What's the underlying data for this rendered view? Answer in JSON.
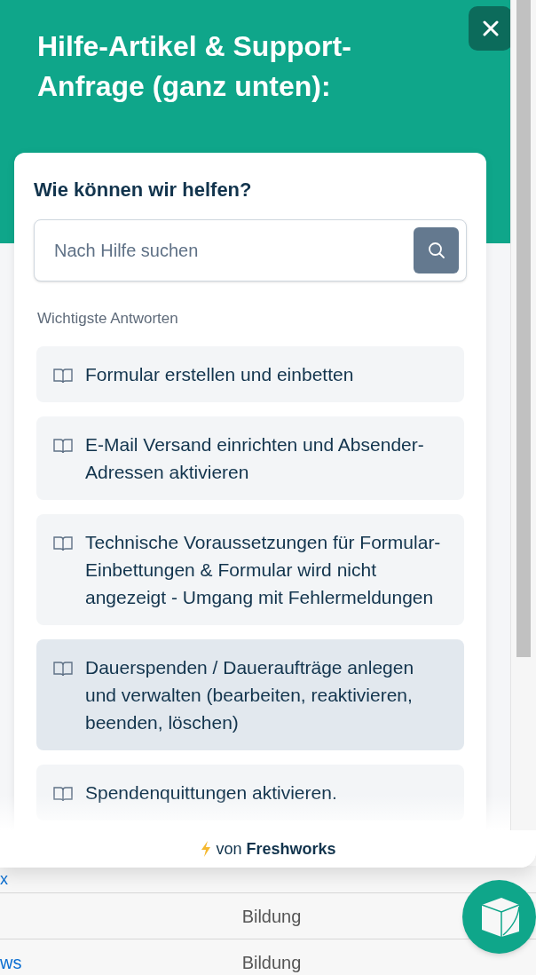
{
  "background_page": {
    "link_top": "x",
    "rows": [
      {
        "link": "",
        "category": "Bildung"
      },
      {
        "link": "ws",
        "category": "Bildung"
      }
    ]
  },
  "widget": {
    "title": "Hilfe-Artikel & Support-Anfrage (ganz unten):",
    "heading": "Wie können wir helfen?",
    "search": {
      "placeholder": "Nach Hilfe suchen"
    },
    "section_label": "Wichtigste Antworten",
    "articles": [
      {
        "title": "Formular erstellen und einbetten",
        "highlighted": false
      },
      {
        "title": "E-Mail Versand einrichten und Absender-Adressen aktivieren",
        "highlighted": false
      },
      {
        "title": "Technische Voraussetzungen für Formular-Einbettungen & Formular wird nicht angezeigt - Umgang mit Fehlermeldungen",
        "highlighted": false
      },
      {
        "title": "Dauerspenden / Daueraufträge anlegen und verwalten (bearbeiten, reaktivieren, beenden, löschen)",
        "highlighted": true
      },
      {
        "title": "Spendenquittungen aktivieren.",
        "highlighted": false
      }
    ],
    "footer": "von **Freshworks**"
  }
}
